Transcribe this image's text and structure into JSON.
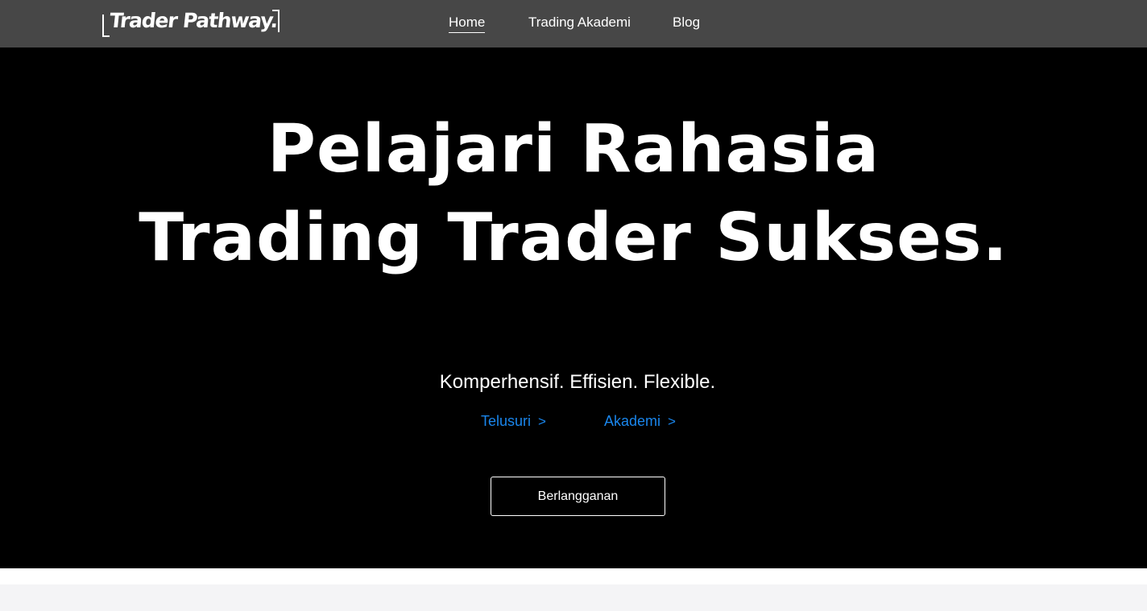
{
  "brand": {
    "logo_text": "Trader Pathway."
  },
  "nav": {
    "items": [
      {
        "label": "Home",
        "active": true
      },
      {
        "label": "Trading Akademi",
        "active": false
      },
      {
        "label": "Blog",
        "active": false
      }
    ]
  },
  "hero": {
    "title_line1": "Pelajari Rahasia",
    "title_line2": "Trading Trader Sukses.",
    "tagline": "Komperhensif. Effisien. Flexible.",
    "links": [
      {
        "label": "Telusuri",
        "icon": "chevron-right-icon"
      },
      {
        "label": "Akademi",
        "icon": "chevron-right-icon"
      }
    ],
    "cta_label": "Berlangganan"
  },
  "colors": {
    "navbar_bg": "#474747",
    "hero_bg": "#000000",
    "link_accent": "#1a86ec",
    "section_bg": "#f4f4f6"
  }
}
